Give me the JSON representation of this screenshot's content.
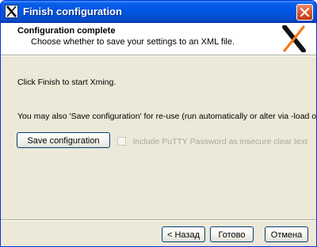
{
  "window": {
    "title": "Finish configuration"
  },
  "header": {
    "title": "Configuration complete",
    "subtitle": "Choose whether to save your settings to an XML file."
  },
  "body": {
    "instruction": "Click Finish to start Xming.",
    "save_hint": "You may also 'Save configuration' for re-use (run automatically or alter via -load option).",
    "save_button_label": "Save configuration",
    "include_password_label": "Include PuTTY Password as insecure clear text",
    "include_password_checked": false,
    "include_password_enabled": false
  },
  "footer": {
    "back_label": "< Назад",
    "finish_label": "Готово",
    "cancel_label": "Отмена"
  },
  "colors": {
    "titlebar": "#0058e6",
    "close_button": "#d9552e",
    "dialog_background": "#ece9d8",
    "logo_orange": "#f27a1a",
    "logo_black": "#111111"
  },
  "icons": {
    "title": "xming-x-icon",
    "close": "close-icon",
    "logo": "xming-logo"
  }
}
